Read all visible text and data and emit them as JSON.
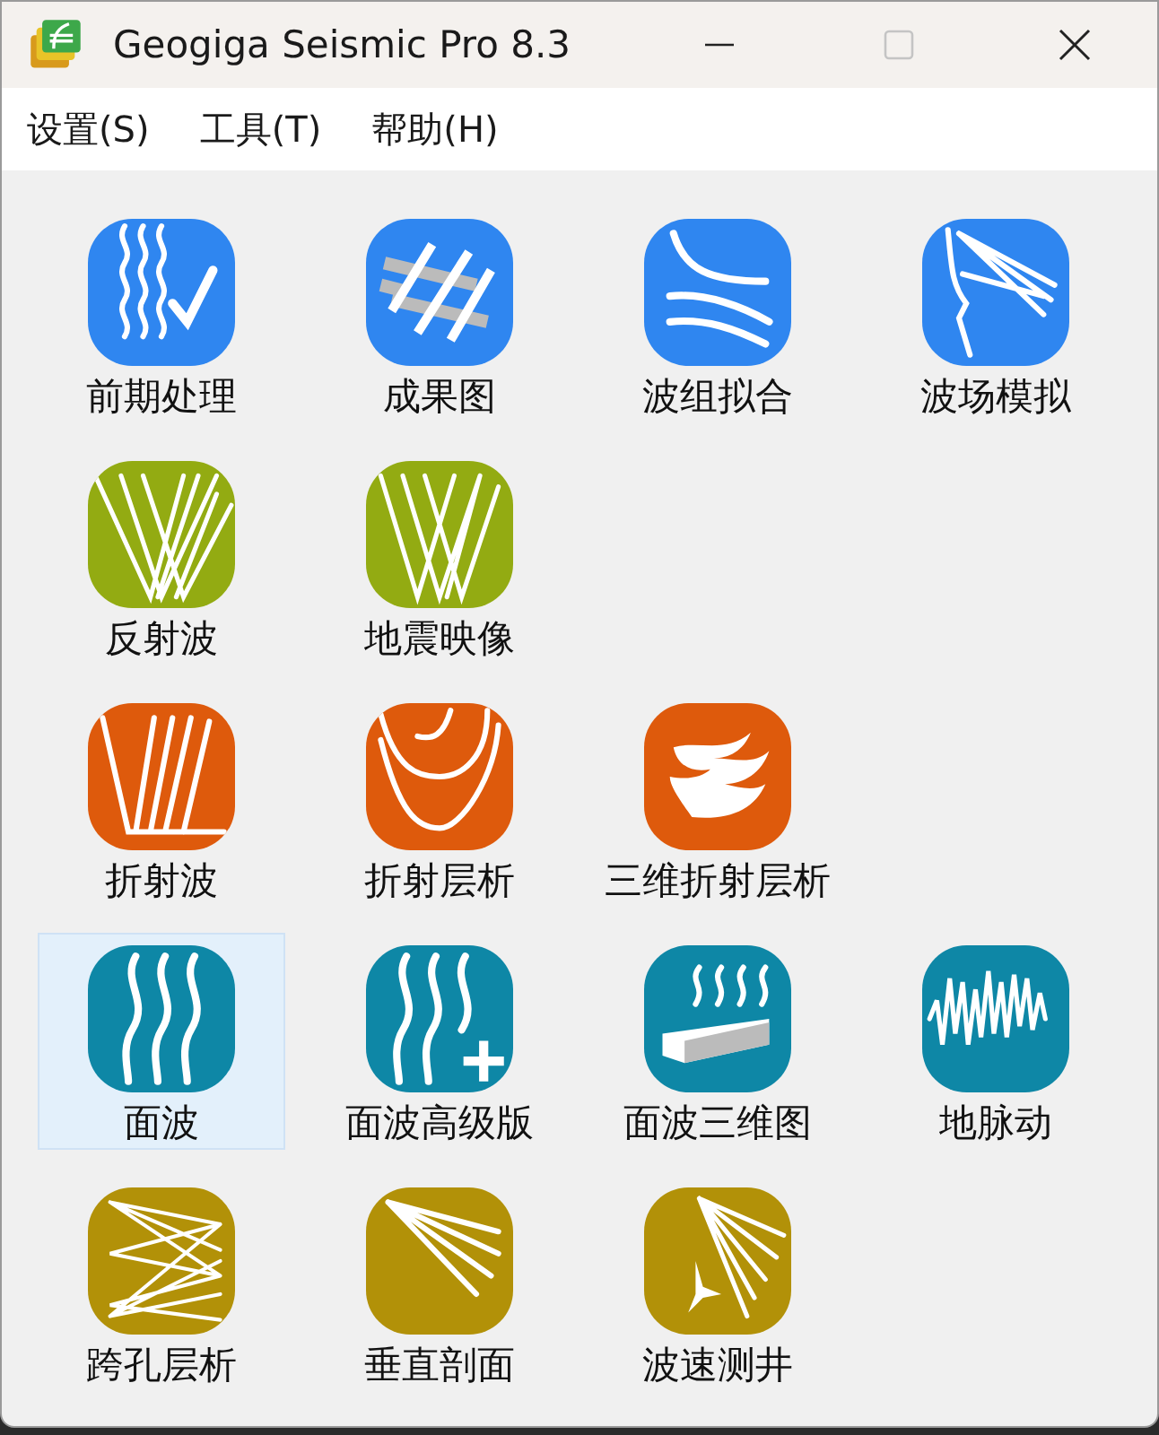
{
  "window": {
    "title": "Geogiga Seismic Pro 8.3",
    "maximize_disabled": true
  },
  "menu": [
    {
      "label": "设置(S)"
    },
    {
      "label": "工具(T)"
    },
    {
      "label": "帮助(H)"
    }
  ],
  "rows": [
    [
      {
        "label": "前期处理",
        "kind": "traces",
        "color": "#2f86f0",
        "selected": false
      },
      {
        "label": "成果图",
        "kind": "grid",
        "color": "#2f86f0",
        "selected": false
      },
      {
        "label": "波组拟合",
        "kind": "curves",
        "color": "#2f86f0",
        "selected": false
      },
      {
        "label": "波场模拟",
        "kind": "fan",
        "color": "#2f86f0",
        "selected": false
      }
    ],
    [
      {
        "label": "反射波",
        "kind": "reflect",
        "color": "#93ab12",
        "selected": false
      },
      {
        "label": "地震映像",
        "kind": "image",
        "color": "#93ab12",
        "selected": false
      }
    ],
    [
      {
        "label": "折射波",
        "kind": "refract",
        "color": "#de5a0c",
        "selected": false
      },
      {
        "label": "折射层析",
        "kind": "valley",
        "color": "#de5a0c",
        "selected": false
      },
      {
        "label": "三维折射层析",
        "kind": "layers",
        "color": "#de5a0c",
        "selected": false
      }
    ],
    [
      {
        "label": "面波",
        "kind": "waves",
        "color": "#0e87a6",
        "selected": true
      },
      {
        "label": "面波高级版",
        "kind": "wavesplus",
        "color": "#0e87a6",
        "selected": false
      },
      {
        "label": "面波三维图",
        "kind": "block",
        "color": "#0e87a6",
        "selected": false
      },
      {
        "label": "地脉动",
        "kind": "noise",
        "color": "#0e87a6",
        "selected": false
      }
    ],
    [
      {
        "label": "跨孔层析",
        "kind": "cross",
        "color": "#b29108",
        "selected": false
      },
      {
        "label": "垂直剖面",
        "kind": "vsp",
        "color": "#b29108",
        "selected": false
      },
      {
        "label": "波速测井",
        "kind": "well",
        "color": "#b29108",
        "selected": false
      }
    ]
  ]
}
